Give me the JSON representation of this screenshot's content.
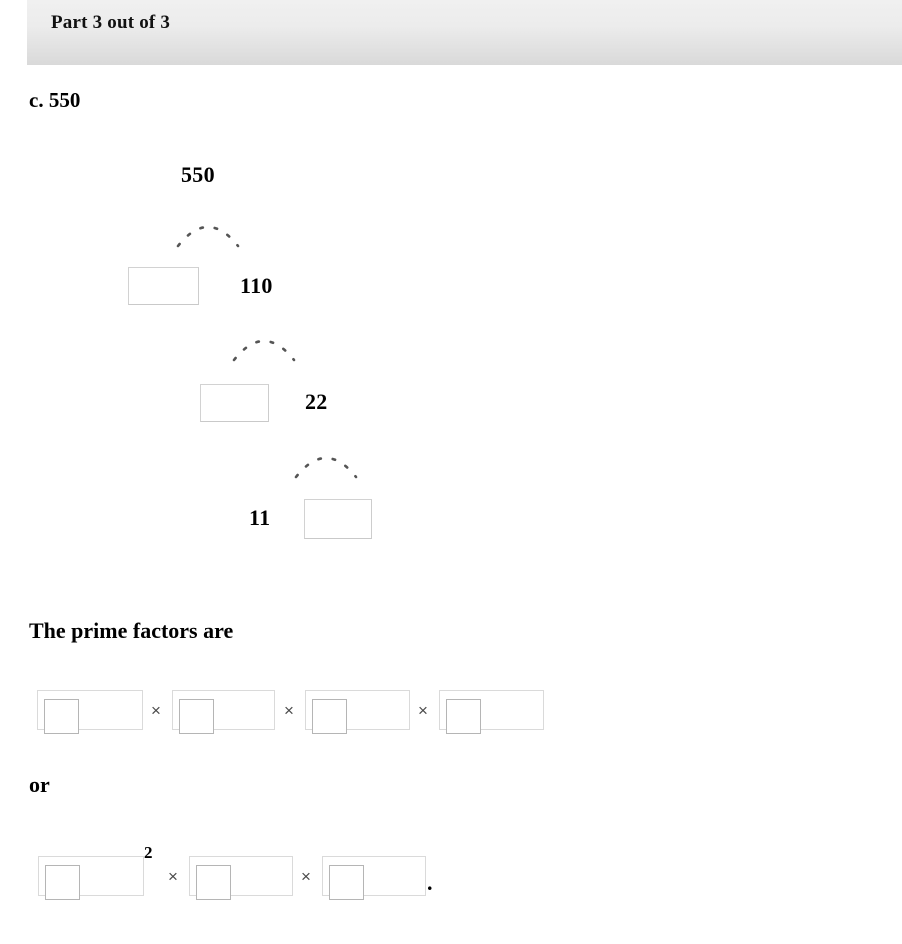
{
  "header": {
    "title": "Part 3 out of 3"
  },
  "question": {
    "label": "c. 550"
  },
  "factor_tree": {
    "root": "550",
    "levels": [
      {
        "left_type": "input",
        "left_value": "",
        "right_type": "number",
        "right_value": "110"
      },
      {
        "left_type": "input",
        "left_value": "",
        "right_type": "number",
        "right_value": "22"
      },
      {
        "left_type": "number",
        "left_value": "11",
        "right_type": "input",
        "right_value": ""
      }
    ]
  },
  "prime_factors": {
    "heading": "The prime factors are",
    "row1": {
      "slots": [
        {
          "value": ""
        },
        {
          "value": ""
        },
        {
          "value": ""
        },
        {
          "value": ""
        }
      ],
      "separators": [
        "×",
        "×",
        "×"
      ]
    },
    "or_label": "or",
    "row2": {
      "slots": [
        {
          "value": ""
        },
        {
          "value": ""
        },
        {
          "value": ""
        }
      ],
      "separators": [
        "×",
        "×"
      ],
      "exponent": "2",
      "terminator": "."
    }
  },
  "colors": {
    "header_gradient_top": "#f0f0f0",
    "header_gradient_bottom": "#d9d9d9",
    "box_border": "#dadada",
    "inner_box_border": "#b5b5b5",
    "text": "#000000",
    "times_symbol": "#4a4a4a",
    "branch_dot": "#555555"
  }
}
